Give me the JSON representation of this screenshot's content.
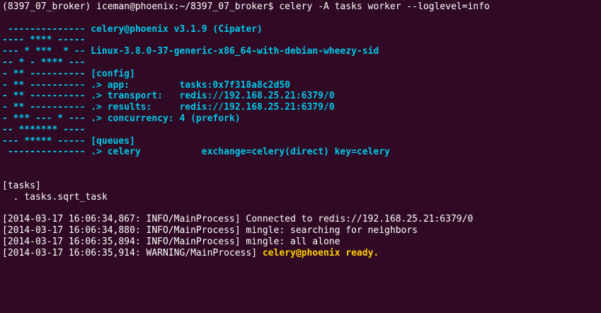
{
  "terminal": {
    "prompt_line": "(8397_07_broker) iceman@phoenix:~/8397_07_broker$ celery -A tasks worker --loglevel=info",
    "banner": [
      "",
      " -------------- celery@phoenix v3.1.9 (Cipater)",
      "---- **** -----",
      "--- * ***  * -- Linux-3.8.0-37-generic-x86_64-with-debian-wheezy-sid",
      "-- * - **** ---",
      "- ** ---------- [config]",
      "- ** ---------- .> app:         tasks:0x7f318a8c2d50",
      "- ** ---------- .> transport:   redis://192.168.25.21:6379/0",
      "- ** ---------- .> results:     redis://192.168.25.21:6379/0",
      "- *** --- * --- .> concurrency: 4 (prefork)",
      "-- ******* ----",
      "--- ***** ----- [queues]",
      " -------------- .> celery           exchange=celery(direct) key=celery"
    ],
    "tasks_header": "[tasks]",
    "task_item": "  . tasks.sqrt_task",
    "logs": [
      "[2014-03-17 16:06:34,867: INFO/MainProcess] Connected to redis://192.168.25.21:6379/0",
      "[2014-03-17 16:06:34,880: INFO/MainProcess] mingle: searching for neighbors",
      "[2014-03-17 16:06:35,894: INFO/MainProcess] mingle: all alone"
    ],
    "warning_prefix": "[2014-03-17 16:06:35,914: WARNING/MainProcess] ",
    "warning_ready": "celery@phoenix ready."
  },
  "colors": {
    "background": "#300a24",
    "banner": "#00c8e8",
    "text": "#ffffff",
    "warning": "#ffd000"
  }
}
